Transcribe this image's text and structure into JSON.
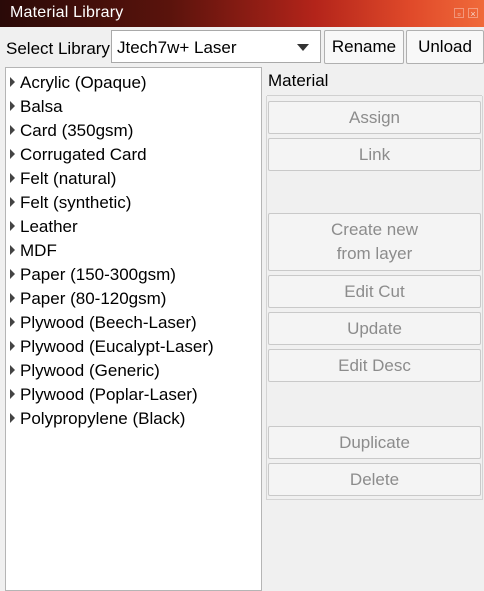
{
  "window": {
    "title": "Material Library",
    "controls": [
      "restore-icon",
      "close-icon"
    ]
  },
  "toolbar": {
    "select_label": "Select Library",
    "library_value": "Jtech7w+ Laser",
    "rename_label": "Rename",
    "unload_label": "Unload"
  },
  "materials": [
    "Acrylic (Opaque)",
    "Balsa",
    "Card (350gsm)",
    "Corrugated Card",
    "Felt (natural)",
    "Felt (synthetic)",
    "Leather",
    "MDF",
    "Paper (150-300gsm)",
    "Paper (80-120gsm)",
    "Plywood (Beech-Laser)",
    "Plywood (Eucalypt-Laser)",
    "Plywood (Generic)",
    "Plywood (Poplar-Laser)",
    "Polypropylene (Black)"
  ],
  "panel": {
    "title": "Material",
    "assign": "Assign",
    "link": "Link",
    "create_line1": "Create new",
    "create_line2": "from layer",
    "edit_cut": "Edit Cut",
    "update": "Update",
    "edit_desc": "Edit Desc",
    "duplicate": "Duplicate",
    "delete": "Delete"
  }
}
